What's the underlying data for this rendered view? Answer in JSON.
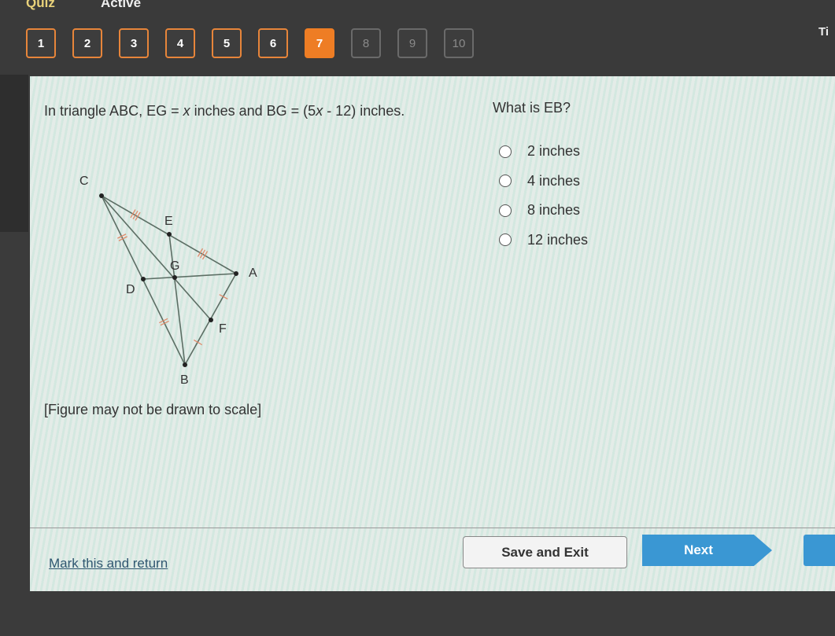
{
  "header": {
    "title": "Quiz",
    "status": "Active",
    "timer_label": "Ti"
  },
  "question_nav": [
    {
      "label": "1",
      "state": "answered"
    },
    {
      "label": "2",
      "state": "answered"
    },
    {
      "label": "3",
      "state": "answered"
    },
    {
      "label": "4",
      "state": "answered"
    },
    {
      "label": "5",
      "state": "answered"
    },
    {
      "label": "6",
      "state": "answered"
    },
    {
      "label": "7",
      "state": "current"
    },
    {
      "label": "8",
      "state": "unvisited"
    },
    {
      "label": "9",
      "state": "unvisited"
    },
    {
      "label": "10",
      "state": "unvisited"
    }
  ],
  "question": {
    "stem_part1": "In triangle ABC, EG = ",
    "var": "x",
    "stem_part2": " inches and BG = (5",
    "stem_part3": " - 12) inches.",
    "prompt": "What is EB?",
    "options": [
      "2 inches",
      "4 inches",
      "8 inches",
      "12 inches"
    ],
    "selected": null,
    "note": "[Figure may not be drawn to scale]"
  },
  "figure": {
    "points": {
      "C": "C",
      "E": "E",
      "A": "A",
      "D": "D",
      "G": "G",
      "F": "F",
      "B": "B"
    },
    "line_color": "#5c6e64",
    "tick_color": "#e08a6a"
  },
  "footer": {
    "mark_label": "Mark this and return",
    "save_label": "Save and Exit",
    "next_label": "Next"
  },
  "colors": {
    "accent": "#ee7d24",
    "button_blue": "#3a97d3",
    "quiz_title": "#e9d27a"
  }
}
